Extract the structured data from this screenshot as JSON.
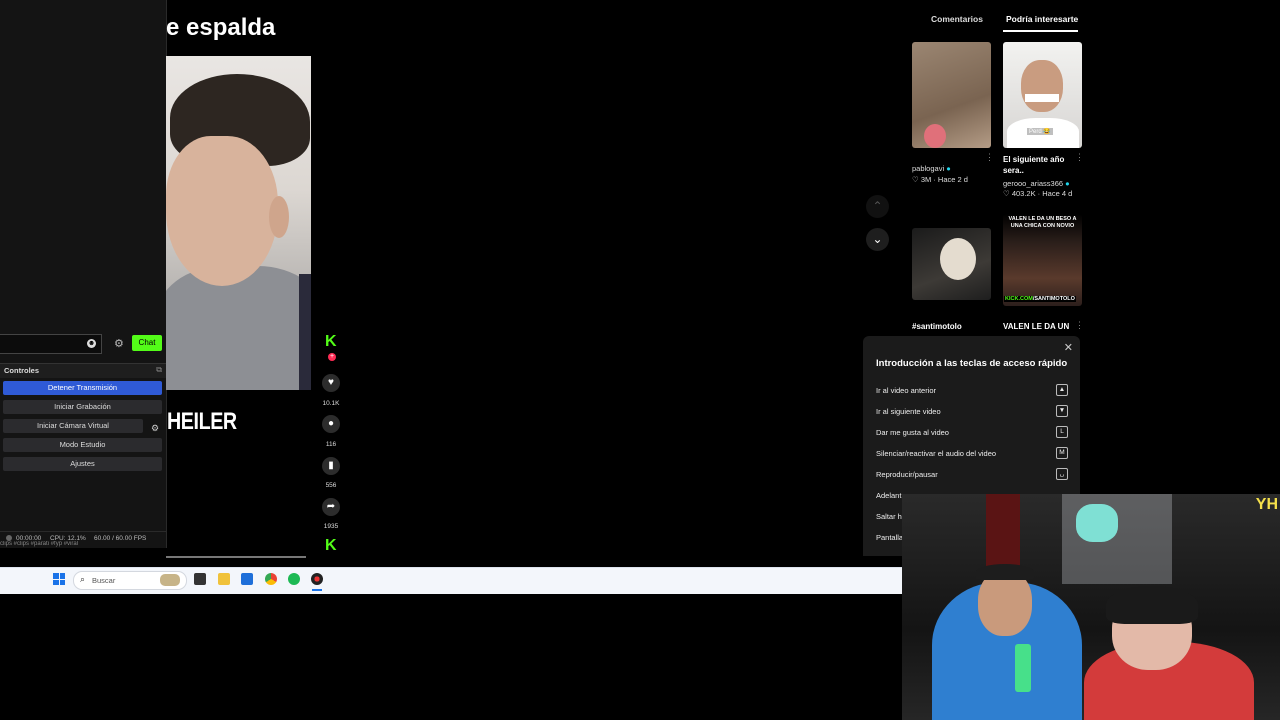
{
  "obs": {
    "chat_label": "Chat",
    "controls_title": "Controles",
    "buttons": [
      "Detener Transmisión",
      "Iniciar Grabación",
      "Iniciar Cámara Virtual",
      "Modo Estudio",
      "Ajustes"
    ],
    "status": {
      "time": "00:00:00",
      "cpu": "CPU: 12.1%",
      "fps": "60.00 / 60.00 FPS"
    },
    "ticker": "clips #clips #parati #fyp #viral"
  },
  "video": {
    "title": "e espalda",
    "caption": "HEILER",
    "likes": "10.1K",
    "comments": "116",
    "saves": "556",
    "shares": "1935"
  },
  "panel": {
    "tabs": [
      "Comentarios",
      "Podría interesarte"
    ],
    "items": [
      {
        "caption": "",
        "author": "pablogavi",
        "stats": "3M · Hace 2 d"
      },
      {
        "caption": "El siguiente año sera..",
        "sticker": "Perd 😂",
        "author": "gerooo_ariass366",
        "stats": "403.2K · Hace 4 d"
      },
      {
        "caption": "#santimotolo"
      },
      {
        "caption": "VALEN LE DA UN",
        "overlay": "VALEN LE DA UN BESO A UNA CHICA CON NOVIO",
        "site": "KICK.COM",
        "handle": "/SANTIMOTOLO"
      }
    ]
  },
  "shortcuts": {
    "title": "Introducción a las teclas de acceso rápido",
    "rows": [
      {
        "label": "Ir al video anterior",
        "key": "▲"
      },
      {
        "label": "Ir al siguiente video",
        "key": "▼"
      },
      {
        "label": "Dar me gusta al video",
        "key": "L"
      },
      {
        "label": "Silenciar/reactivar el audio del video",
        "key": "M"
      },
      {
        "label": "Reproducir/pausar",
        "key": "␣"
      },
      {
        "label": "Adelant",
        "key": ""
      },
      {
        "label": "Saltar h",
        "key": ""
      },
      {
        "label": "Pantalla",
        "key": ""
      }
    ]
  },
  "taskbar": {
    "search_placeholder": "Buscar"
  },
  "webcam": {
    "corner_text": "YH"
  },
  "colors": {
    "kick_green": "#53fc18",
    "obs_primary": "#2f5ad6",
    "tiktok_red": "#fe2c55"
  }
}
